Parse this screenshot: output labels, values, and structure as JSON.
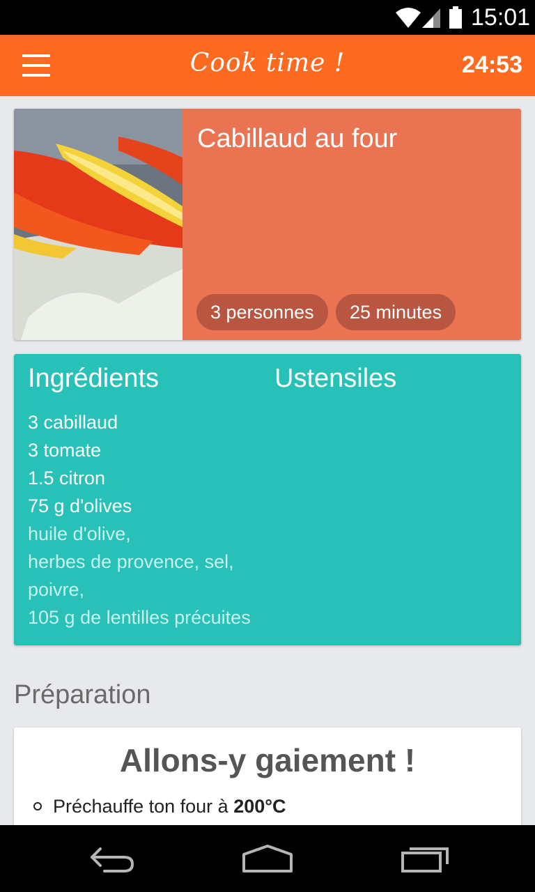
{
  "status_bar": {
    "time": "15:01",
    "icons": [
      "wifi-icon",
      "signal-icon",
      "battery-icon"
    ]
  },
  "app_bar": {
    "menu_icon": "hamburger-menu-icon",
    "title": "Cook time !",
    "timer": "24:53"
  },
  "recipe": {
    "title": "Cabillaud au four",
    "servings": "3 personnes",
    "duration": "25 minutes",
    "image": "cod-with-tomato-and-lemon-photo"
  },
  "ingredients": {
    "heading": "Ingrédients",
    "utensils_heading": "Ustensiles",
    "items": [
      {
        "label": "3 cabillaud",
        "optional": false
      },
      {
        "label": "3 tomate",
        "optional": false
      },
      {
        "label": "1.5 citron",
        "optional": false
      },
      {
        "label": "75 g d'olives",
        "optional": false
      },
      {
        "label": "huile d'olive,",
        "optional": true
      },
      {
        "label": "herbes de provence,  sel,",
        "optional": true
      },
      {
        "label": "poivre,",
        "optional": true
      },
      {
        "label": "105 g de lentilles précuites",
        "optional": true
      }
    ]
  },
  "preparation": {
    "heading": "Préparation",
    "title": "Allons-y gaiement !",
    "step_text": "Préchauffe ton four à ",
    "step_bold": "200°C"
  },
  "nav_bar": {
    "back_icon": "back-icon",
    "home_icon": "home-icon",
    "recent_icon": "recent-apps-icon"
  },
  "colors": {
    "app_bar": "#ff6a21",
    "recipe_card": "#ea7452",
    "pill": "#b95641",
    "ingredients_card": "#27c1b8",
    "background": "#e8e9ec"
  }
}
